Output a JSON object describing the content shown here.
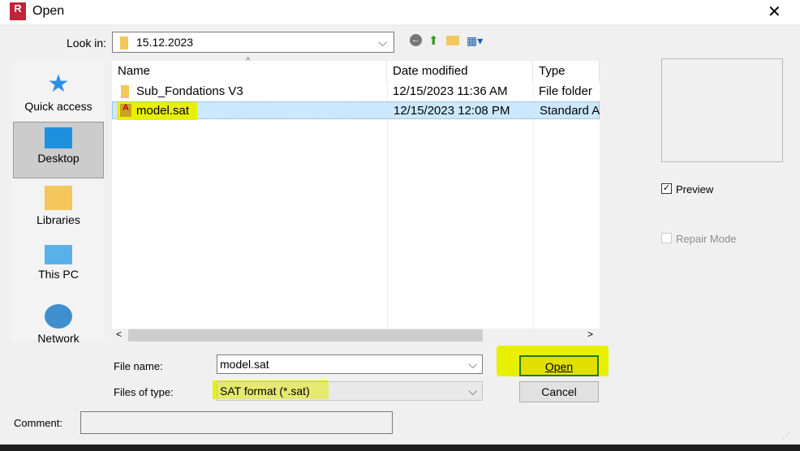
{
  "window": {
    "title": "Open"
  },
  "look_in": {
    "label": "Look in:",
    "value": "15.12.2023"
  },
  "places": [
    {
      "label": "Quick access"
    },
    {
      "label": "Desktop"
    },
    {
      "label": "Libraries"
    },
    {
      "label": "This PC"
    },
    {
      "label": "Network"
    }
  ],
  "columns": {
    "name": "Name",
    "date": "Date modified",
    "type": "Type"
  },
  "files": [
    {
      "name": "Sub_Fondations V3",
      "date": "12/15/2023 11:36 AM",
      "type": "File folder"
    },
    {
      "name": "model.sat",
      "date": "12/15/2023 12:08 PM",
      "type": "Standard A"
    }
  ],
  "file_name": {
    "label": "File name:",
    "value": "model.sat"
  },
  "file_type": {
    "label": "Files of type:",
    "value": "SAT format (*.sat)"
  },
  "buttons": {
    "open": "Open",
    "cancel": "Cancel"
  },
  "preview": {
    "label": "Preview",
    "checked": true
  },
  "repair": {
    "label": "Repair Mode",
    "checked": false
  },
  "comment": {
    "label": "Comment:",
    "value": ""
  }
}
